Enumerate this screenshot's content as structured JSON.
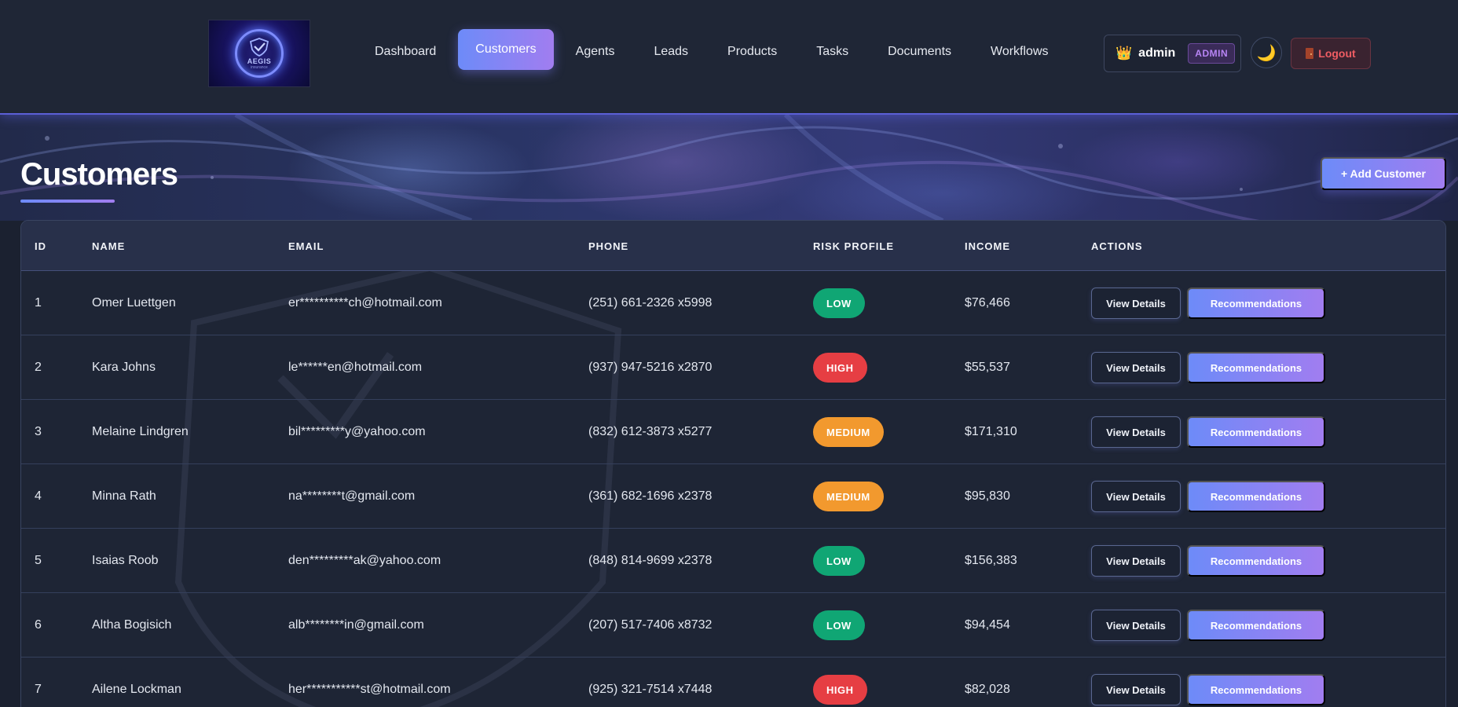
{
  "app": {
    "logo": {
      "text": "AEGIS",
      "subtext": "insurance"
    }
  },
  "nav": {
    "items": [
      {
        "label": "Dashboard"
      },
      {
        "label": "Customers",
        "active": true
      },
      {
        "label": "Agents"
      },
      {
        "label": "Leads"
      },
      {
        "label": "Products"
      },
      {
        "label": "Tasks"
      },
      {
        "label": "Documents"
      },
      {
        "label": "Workflows"
      }
    ]
  },
  "user": {
    "icon": "crown-icon",
    "name": "admin",
    "role": "ADMIN"
  },
  "theme_toggle": {
    "icon": "moon-icon",
    "glyph": "🌙"
  },
  "logout": {
    "icon": "door-icon",
    "label": "Logout"
  },
  "page": {
    "title": "Customers",
    "add_button": "+ Add Customer"
  },
  "table": {
    "columns": [
      "ID",
      "NAME",
      "EMAIL",
      "PHONE",
      "RISK PROFILE",
      "INCOME",
      "ACTIONS"
    ],
    "view_label": "View Details",
    "rec_label": "Recommendations",
    "risk_colors": {
      "LOW": "#10a674",
      "HIGH": "#e63e43",
      "MEDIUM": "#f2992e"
    },
    "rows": [
      {
        "id": "1",
        "name": "Omer Luettgen",
        "email": "er**********ch@hotmail.com",
        "phone": "(251) 661-2326 x5998",
        "risk": "LOW",
        "income": "$76,466"
      },
      {
        "id": "2",
        "name": "Kara Johns",
        "email": "le******en@hotmail.com",
        "phone": "(937) 947-5216 x2870",
        "risk": "HIGH",
        "income": "$55,537"
      },
      {
        "id": "3",
        "name": "Melaine Lindgren",
        "email": "bil*********y@yahoo.com",
        "phone": "(832) 612-3873 x5277",
        "risk": "MEDIUM",
        "income": "$171,310"
      },
      {
        "id": "4",
        "name": "Minna Rath",
        "email": "na********t@gmail.com",
        "phone": "(361) 682-1696 x2378",
        "risk": "MEDIUM",
        "income": "$95,830"
      },
      {
        "id": "5",
        "name": "Isaias Roob",
        "email": "den*********ak@yahoo.com",
        "phone": "(848) 814-9699 x2378",
        "risk": "LOW",
        "income": "$156,383"
      },
      {
        "id": "6",
        "name": "Altha Bogisich",
        "email": "alb********in@gmail.com",
        "phone": "(207) 517-7406 x8732",
        "risk": "LOW",
        "income": "$94,454"
      },
      {
        "id": "7",
        "name": "Ailene Lockman",
        "email": "her***********st@hotmail.com",
        "phone": "(925) 321-7514 x7448",
        "risk": "HIGH",
        "income": "$82,028"
      }
    ]
  },
  "colors": {
    "accent_start": "#6d8bf8",
    "accent_end": "#a17df0",
    "background": "#1b2130",
    "logout": "#ef5d63"
  }
}
